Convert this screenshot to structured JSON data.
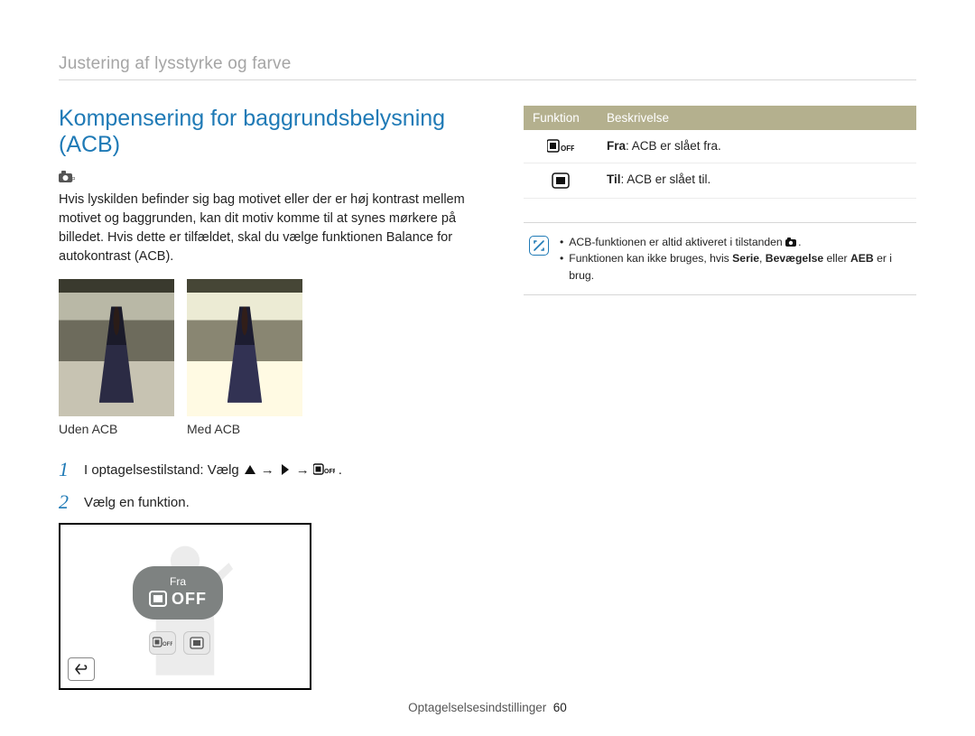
{
  "breadcrumb": "Justering af lysstyrke og farve",
  "title": "Kompensering for baggrundsbelysning (ACB)",
  "body_text": "Hvis lyskilden befinder sig bag motivet eller der er høj kontrast mellem motivet og baggrunden, kan dit motiv komme til at synes mørkere på billedet. Hvis dette er tilfældet, skal du vælge funktionen Balance for autokontrast (ACB).",
  "captions": {
    "without": "Uden ACB",
    "with": "Med ACB"
  },
  "steps": {
    "s1_prefix": "I optagelsestilstand: Vælg",
    "s2": "Vælg en funktion."
  },
  "screen": {
    "bubble_label": "Fra",
    "bubble_off": "OFF"
  },
  "table": {
    "header": {
      "col1": "Funktion",
      "col2": "Beskrivelse"
    },
    "rows": [
      {
        "label": "Fra",
        "desc": ": ACB er slået fra."
      },
      {
        "label": "Til",
        "desc": ": ACB er slået til."
      }
    ]
  },
  "notes": {
    "line1_a": "ACB-funktionen er altid aktiveret i tilstanden ",
    "line1_b": ".",
    "line2_a": "Funktionen kan ikke bruges, hvis ",
    "line2_b": "Serie",
    "line2_c": ", ",
    "line2_d": "Bevægelse",
    "line2_e": " eller ",
    "line2_f": "AEB",
    "line2_g": " er i brug."
  },
  "footer": {
    "section": "Optagelselsesindstillinger",
    "page": "60"
  }
}
